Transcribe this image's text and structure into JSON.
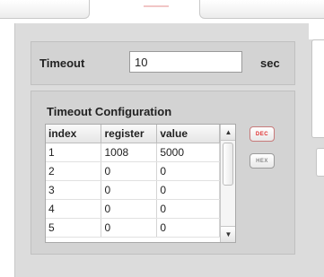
{
  "timeout": {
    "label": "Timeout",
    "value": "10",
    "unit": "sec"
  },
  "config": {
    "title": "Timeout Configuration",
    "columns": [
      "index",
      "register",
      "value"
    ],
    "rows": [
      [
        "1",
        "1008",
        "5000"
      ],
      [
        "2",
        "0",
        "0"
      ],
      [
        "3",
        "0",
        "0"
      ],
      [
        "4",
        "0",
        "0"
      ],
      [
        "5",
        "0",
        "0"
      ]
    ]
  },
  "radix": {
    "dec_label": "DEC",
    "hex_label": "HEX",
    "selected": "DEC"
  },
  "colors": {
    "panel": "#dcdcdc",
    "active_radix": "#e03030"
  }
}
